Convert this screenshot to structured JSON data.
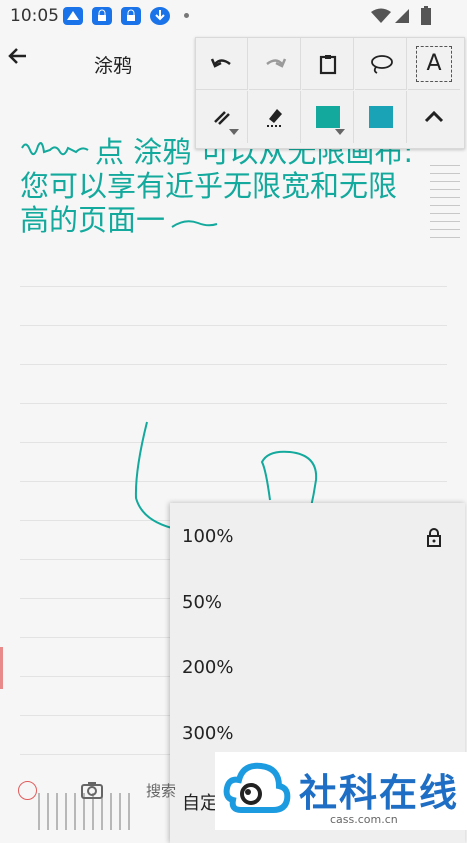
{
  "status": {
    "time": "10:05"
  },
  "appbar": {
    "title": "涂鸦"
  },
  "toolbar": {
    "row1": [
      {
        "name": "undo-icon"
      },
      {
        "name": "redo-icon"
      },
      {
        "name": "clipboard-icon"
      },
      {
        "name": "lasso-icon"
      },
      {
        "name": "text-tool-icon",
        "label": "A"
      }
    ],
    "row2": [
      {
        "name": "brush-icon"
      },
      {
        "name": "eraser-icon"
      },
      {
        "name": "color-swatch",
        "color": "#13a99c"
      },
      {
        "name": "color-swatch-2",
        "color": "#1aa3b6"
      },
      {
        "name": "collapse-icon"
      }
    ]
  },
  "canvas": {
    "text_line1": "点 涂鸦 可以从无限画布:",
    "text_line2": "您可以享有近乎无限宽和无限",
    "text_line3": "高的页面一"
  },
  "zoom_menu": {
    "items": [
      "100%",
      "50%",
      "200%",
      "300%",
      "自定"
    ]
  },
  "bottom": {
    "search_label": "搜索"
  },
  "watermark": {
    "title": "社科在线",
    "subtitle": "cass.com.cn"
  }
}
